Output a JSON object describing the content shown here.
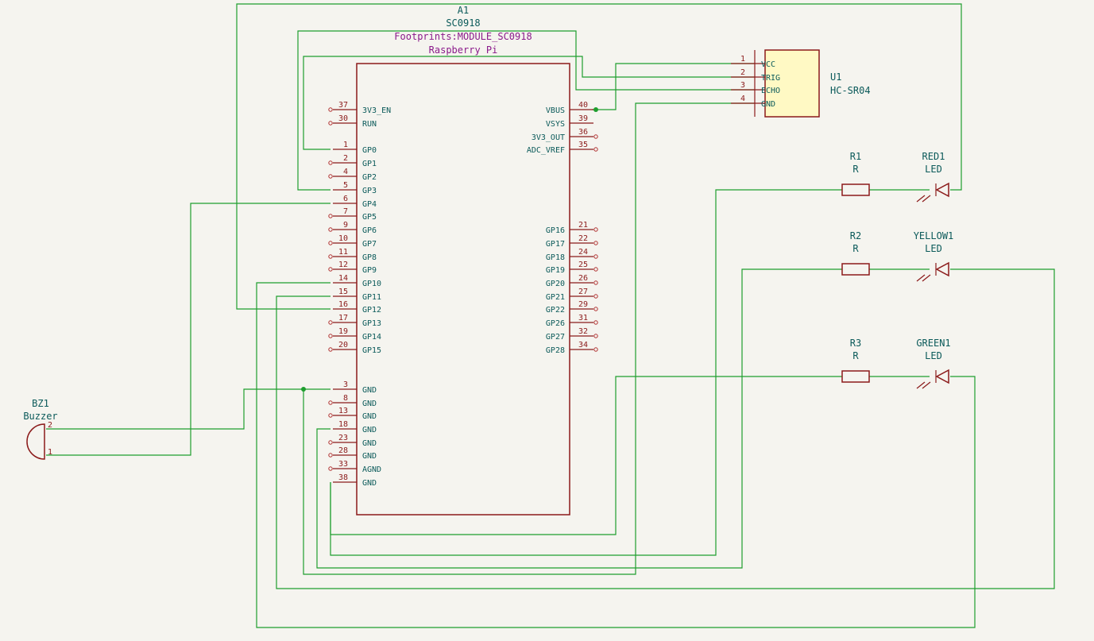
{
  "a1": {
    "ref": "A1",
    "value": "SC0918",
    "footprint": "Footprints:MODULE_SC0918",
    "description": "Raspberry Pi",
    "left_pins": [
      {
        "num": "37",
        "name": "3V3_EN"
      },
      {
        "num": "30",
        "name": "RUN"
      },
      {
        "num": "1",
        "name": "GP0"
      },
      {
        "num": "2",
        "name": "GP1"
      },
      {
        "num": "4",
        "name": "GP2"
      },
      {
        "num": "5",
        "name": "GP3"
      },
      {
        "num": "6",
        "name": "GP4"
      },
      {
        "num": "7",
        "name": "GP5"
      },
      {
        "num": "9",
        "name": "GP6"
      },
      {
        "num": "10",
        "name": "GP7"
      },
      {
        "num": "11",
        "name": "GP8"
      },
      {
        "num": "12",
        "name": "GP9"
      },
      {
        "num": "14",
        "name": "GP10"
      },
      {
        "num": "15",
        "name": "GP11"
      },
      {
        "num": "16",
        "name": "GP12"
      },
      {
        "num": "17",
        "name": "GP13"
      },
      {
        "num": "19",
        "name": "GP14"
      },
      {
        "num": "20",
        "name": "GP15"
      },
      {
        "num": "3",
        "name": "GND"
      },
      {
        "num": "8",
        "name": "GND"
      },
      {
        "num": "13",
        "name": "GND"
      },
      {
        "num": "18",
        "name": "GND"
      },
      {
        "num": "23",
        "name": "GND"
      },
      {
        "num": "28",
        "name": "GND"
      },
      {
        "num": "33",
        "name": "AGND"
      },
      {
        "num": "38",
        "name": "GND"
      }
    ],
    "right_pins": [
      {
        "num": "40",
        "name": "VBUS"
      },
      {
        "num": "39",
        "name": "VSYS"
      },
      {
        "num": "36",
        "name": "3V3_OUT"
      },
      {
        "num": "35",
        "name": "ADC_VREF"
      },
      {
        "num": "21",
        "name": "GP16"
      },
      {
        "num": "22",
        "name": "GP17"
      },
      {
        "num": "24",
        "name": "GP18"
      },
      {
        "num": "25",
        "name": "GP19"
      },
      {
        "num": "26",
        "name": "GP20"
      },
      {
        "num": "27",
        "name": "GP21"
      },
      {
        "num": "29",
        "name": "GP22"
      },
      {
        "num": "31",
        "name": "GP26"
      },
      {
        "num": "32",
        "name": "GP27"
      },
      {
        "num": "34",
        "name": "GP28"
      }
    ]
  },
  "u1": {
    "ref": "U1",
    "value": "HC-SR04",
    "pins": [
      {
        "num": "1",
        "name": "VCC"
      },
      {
        "num": "2",
        "name": "TRIG"
      },
      {
        "num": "3",
        "name": "ECHO"
      },
      {
        "num": "4",
        "name": "GND"
      }
    ]
  },
  "bz1": {
    "ref": "BZ1",
    "value": "Buzzer",
    "pin2": "2",
    "pin1": "1"
  },
  "resistors": [
    {
      "ref": "R1",
      "value": "R"
    },
    {
      "ref": "R2",
      "value": "R"
    },
    {
      "ref": "R3",
      "value": "R"
    }
  ],
  "leds": [
    {
      "ref": "RED1",
      "value": "LED"
    },
    {
      "ref": "YELLOW1",
      "value": "LED"
    },
    {
      "ref": "GREEN1",
      "value": "LED"
    }
  ],
  "colors": {
    "background": "#f5f4ef",
    "wire": "#1e9e2e",
    "symbol": "#8b1a1a",
    "symbol_fill": "#fff9c4",
    "label": "#0b5a5a",
    "footprint": "#8a1a8a"
  }
}
